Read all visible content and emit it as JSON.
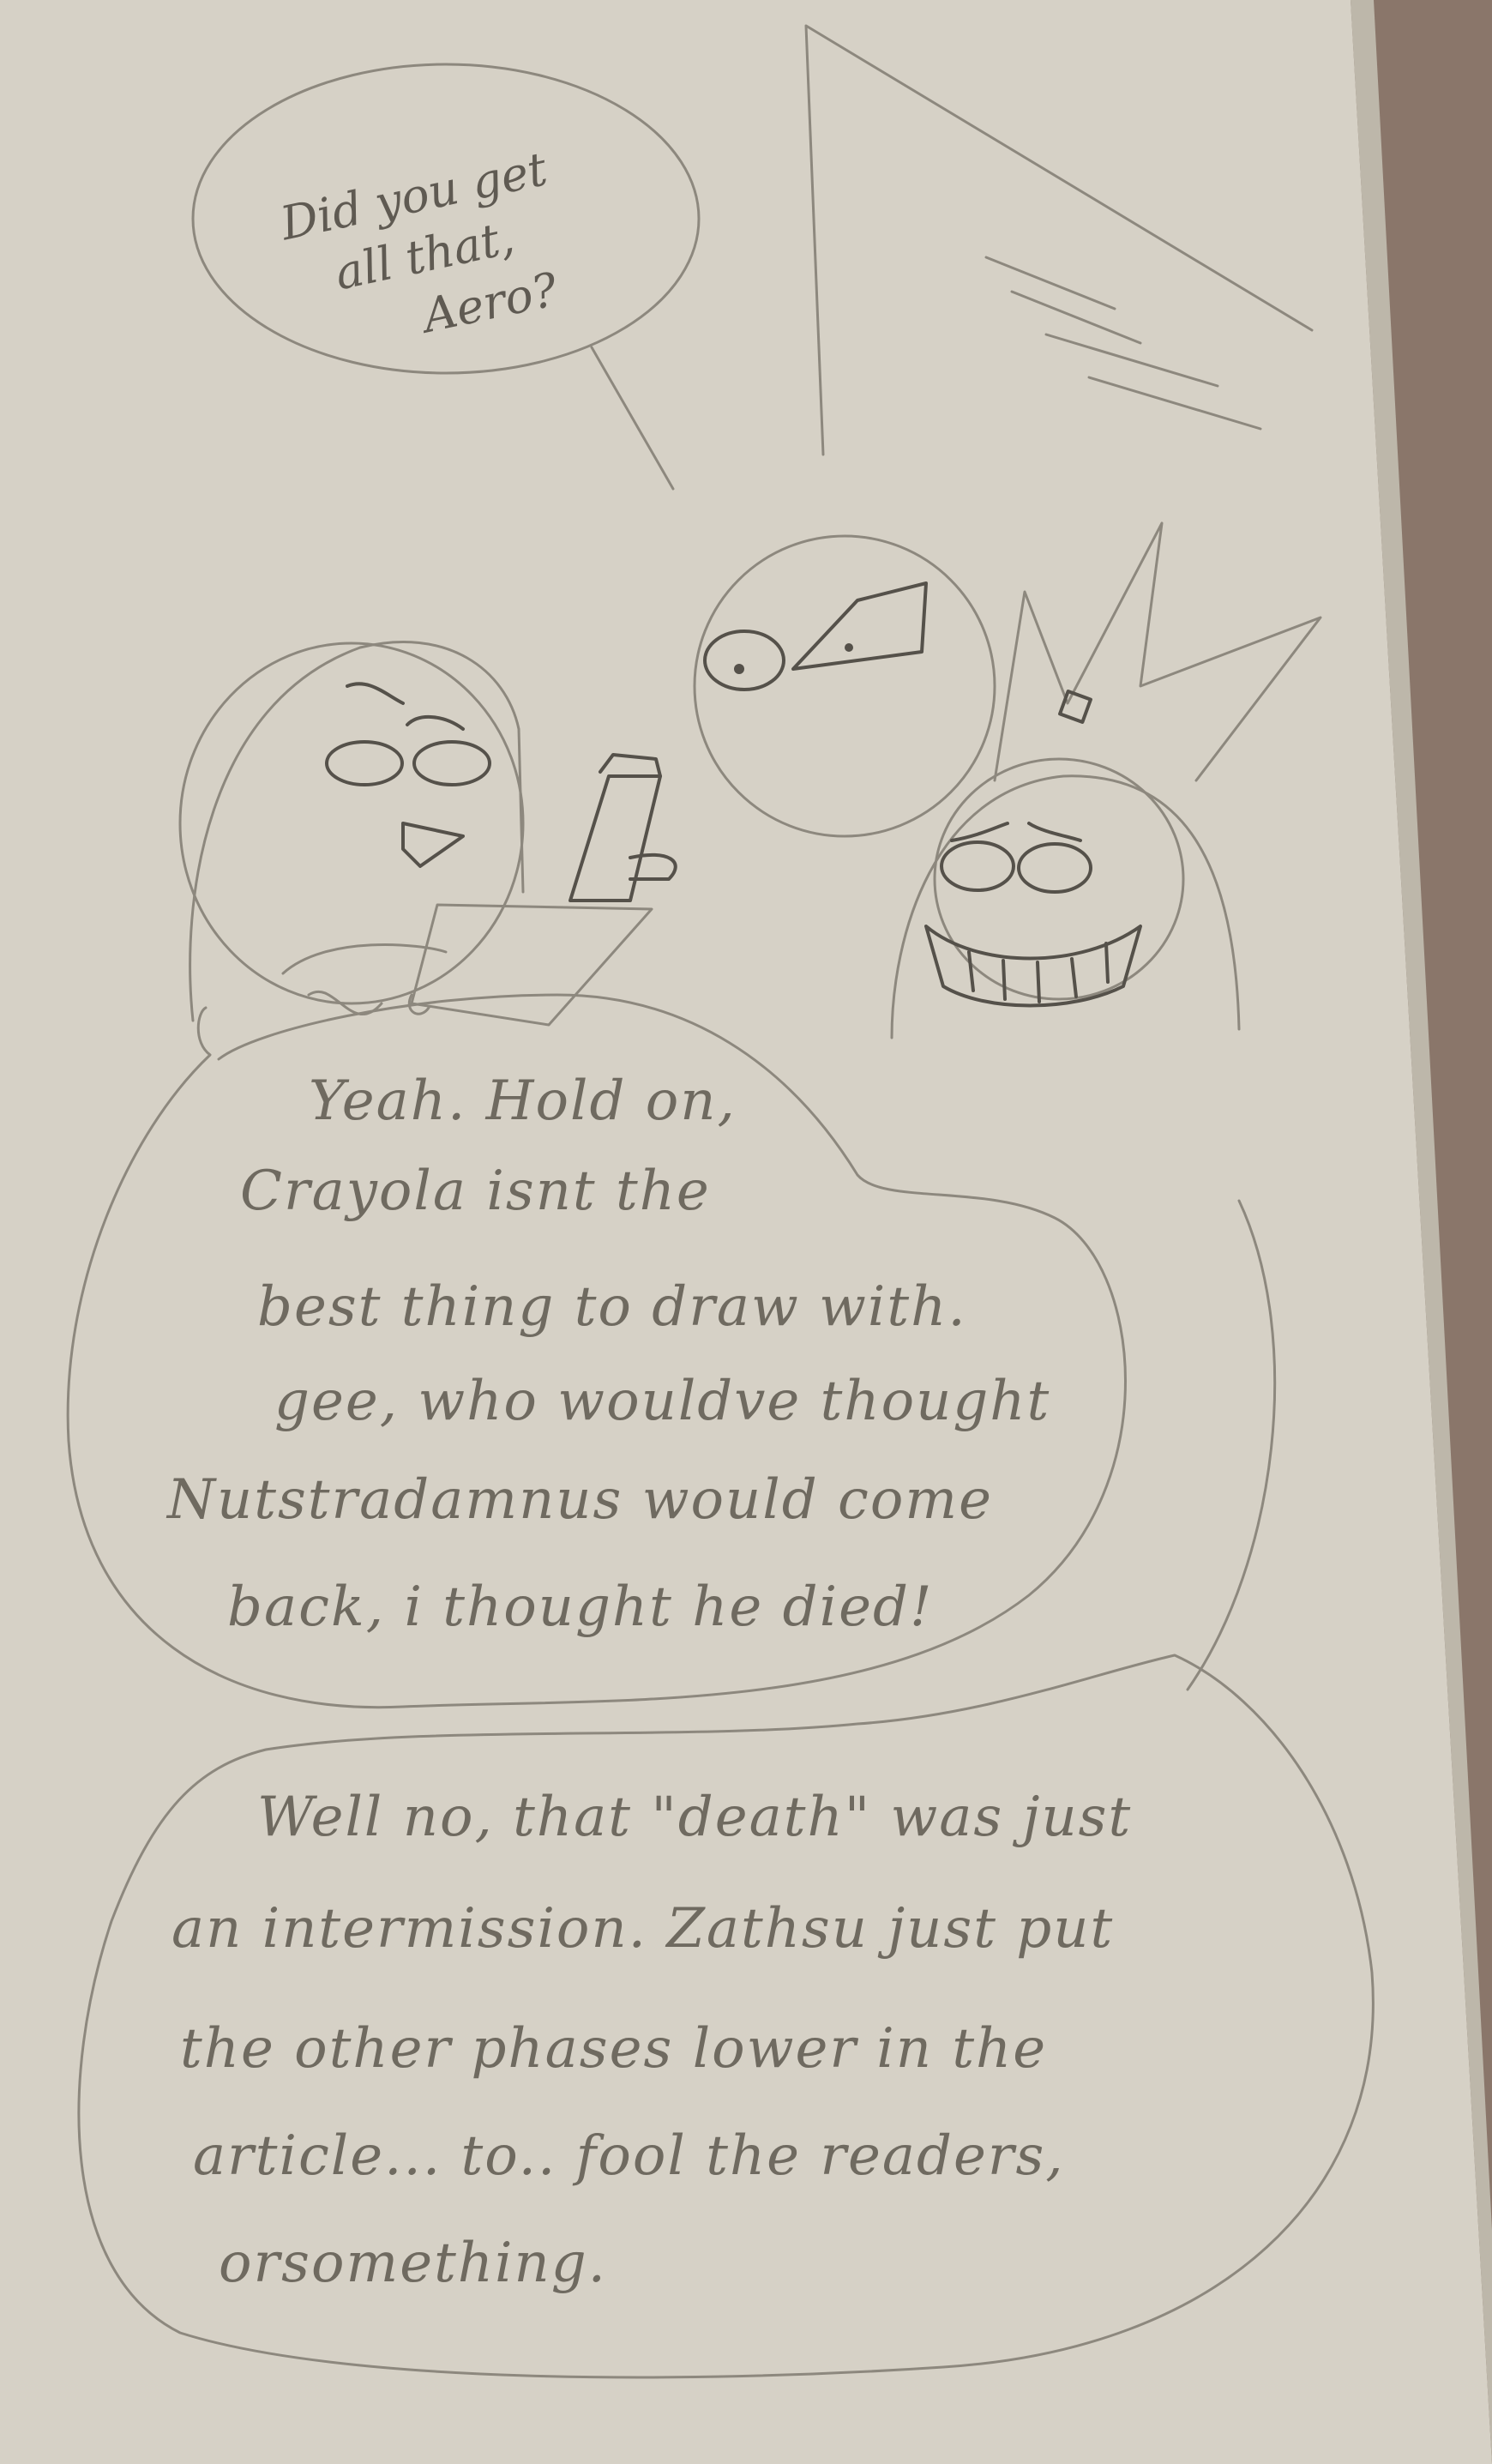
{
  "colors": {
    "paper": "#d6d1c6",
    "paper_shadow": "#bdb7aa",
    "background": "#8a766a",
    "pencil": "#6f6a60"
  },
  "bubbles": {
    "top": {
      "lines": [
        "Did you get",
        "all that,",
        "Aero?"
      ]
    },
    "middle": {
      "lines": [
        "Yeah. Hold on,",
        "Crayola isnt the",
        "best thing to draw with.",
        "gee, who wouldve thought",
        "Nutstradamnus would come",
        "back, i thought he died!"
      ]
    },
    "bottom": {
      "lines": [
        "Well no, that \"death\" was just",
        "an intermission. Zathsu just put",
        "the other phases lower in the",
        "article... to.. fool the readers,",
        "orsomething."
      ]
    }
  }
}
